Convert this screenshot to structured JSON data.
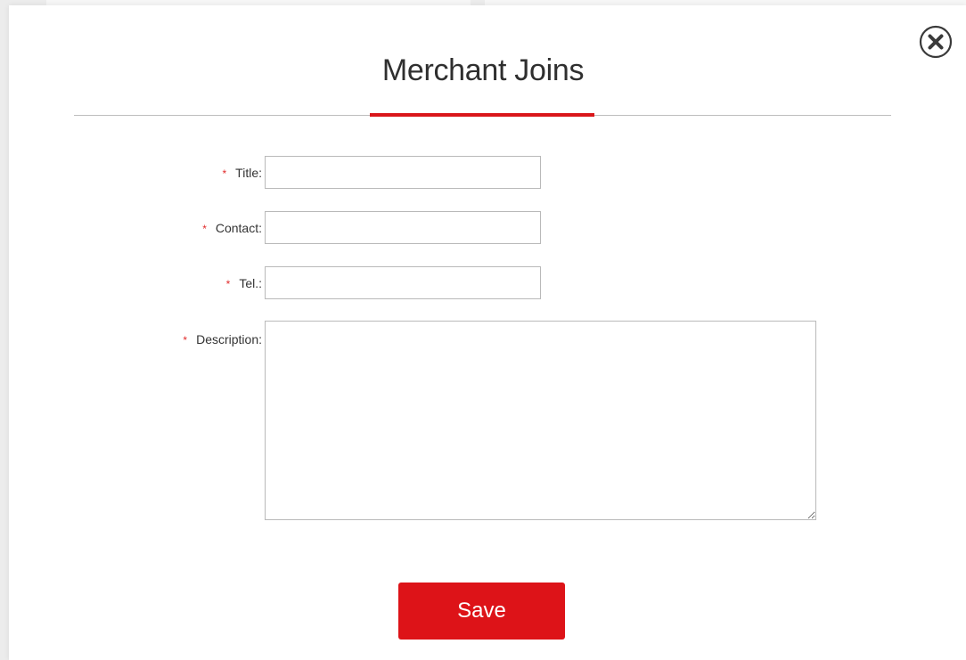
{
  "dialog": {
    "title": "Merchant Joins",
    "close_icon": "close-circle-icon",
    "accent_color": "#d9161a"
  },
  "form": {
    "required_marker": "*",
    "fields": [
      {
        "label": "Title:",
        "value": "",
        "placeholder": ""
      },
      {
        "label": "Contact:",
        "value": "",
        "placeholder": ""
      },
      {
        "label": "Tel.:",
        "value": "",
        "placeholder": ""
      },
      {
        "label": "Description:",
        "value": "",
        "placeholder": ""
      }
    ]
  },
  "actions": {
    "save_label": "Save",
    "save_color": "#dd1318"
  }
}
